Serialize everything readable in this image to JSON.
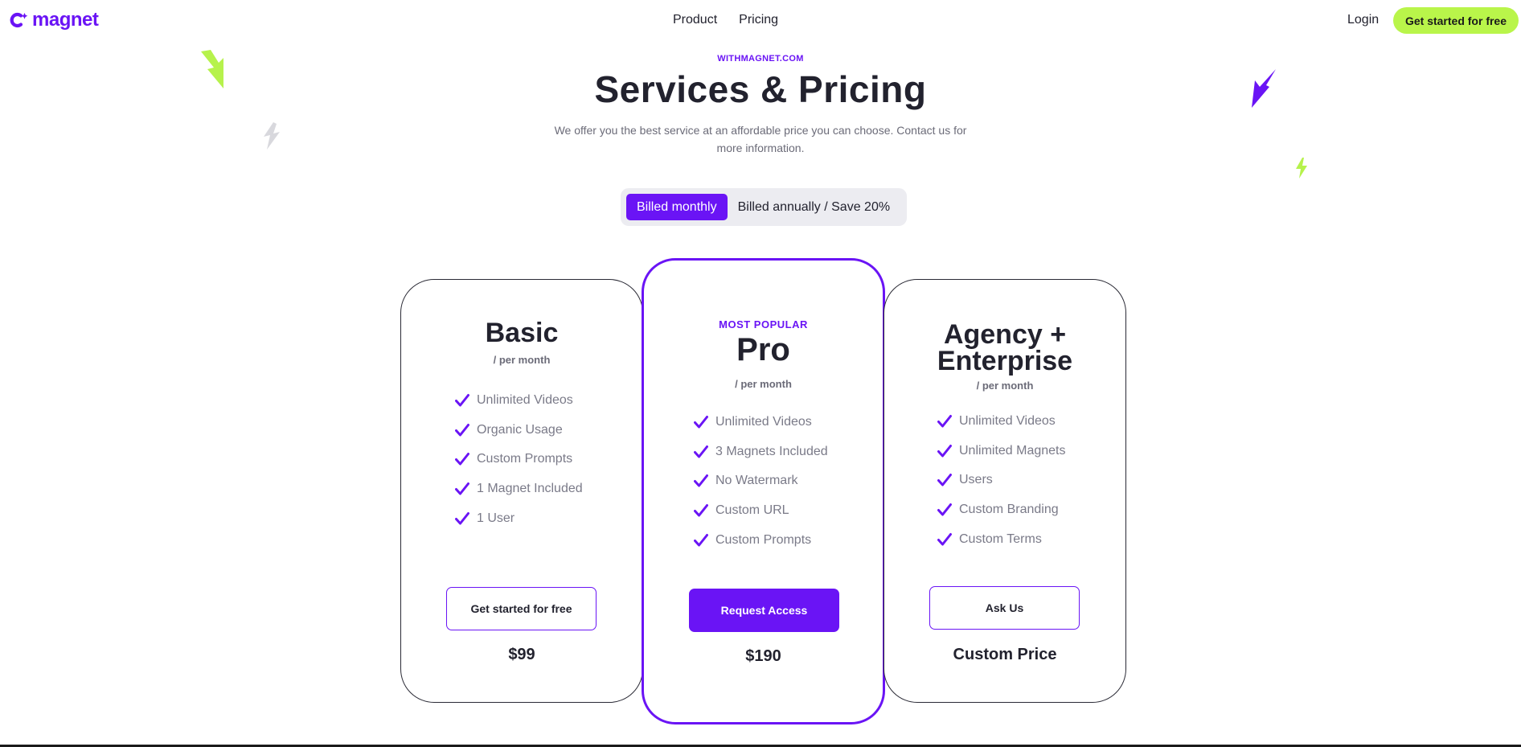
{
  "nav": {
    "brand": "magnet",
    "links": [
      "Product",
      "Pricing"
    ],
    "login": "Login",
    "cta": "Get started for free"
  },
  "hero": {
    "eyebrow": "WITHMAGNET.COM",
    "title": "Services & Pricing",
    "subtitle": "We offer you the best service at an affordable price you can choose. Contact us for more information."
  },
  "billing": {
    "monthly": "Billed monthly",
    "annually": "Billed annually / Save 20%",
    "selected": "monthly"
  },
  "plans": [
    {
      "name": "Basic",
      "period": "/ per month",
      "features": [
        "Unlimited Videos",
        "Organic Usage",
        "Custom Prompts",
        "1 Magnet Included",
        "1 User"
      ],
      "button": "Get started for free",
      "price": "$99"
    },
    {
      "tag": "MOST POPULAR",
      "name": "Pro",
      "period": "/ per month",
      "features": [
        "Unlimited Videos",
        "3 Magnets Included",
        "No Watermark",
        "Custom URL",
        "Custom Prompts"
      ],
      "button": "Request Access",
      "price": "$190"
    },
    {
      "name_line1": "Agency +",
      "name_line2": "Enterprise",
      "period": "/ per month",
      "features": [
        "Unlimited Videos",
        "Unlimited Magnets",
        "Users",
        "Custom Branding",
        "Custom Terms"
      ],
      "button": "Ask Us",
      "price": "Custom Price"
    }
  ],
  "colors": {
    "brand": "#6a14f5",
    "accent_green": "#b9f54a",
    "text": "#22222e",
    "muted": "#7a7a88"
  }
}
